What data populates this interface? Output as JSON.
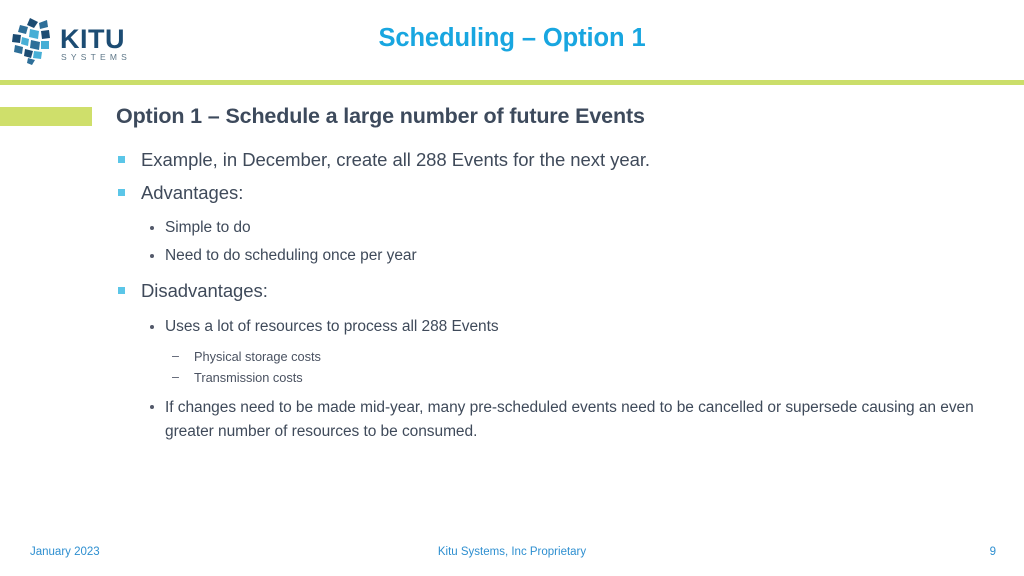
{
  "brand": {
    "logo_name": "kitu-systems-logo",
    "wordmark": "KITU",
    "tagline": "SYSTEMS",
    "mark_dark": "#1C4C73",
    "mark_light": "#47AFD6"
  },
  "header": {
    "title": "Scheduling – Option 1",
    "title_color": "#18A6E0",
    "rule_color": "#CBDE6A"
  },
  "section": {
    "heading": "Option 1 – Schedule a large number of future Events",
    "heading_color": "#3D4A5C",
    "accent_color": "#CFDF6B"
  },
  "bullets": {
    "marker_color_l1": "#5BC6E8",
    "marker_color_l2": "#53596A",
    "dash_glyph": "–",
    "items": [
      {
        "level": 1,
        "text": "Example, in December, create all 288 Events for the next year."
      },
      {
        "level": 1,
        "text": "Advantages:"
      },
      {
        "level": 2,
        "text": "Simple to do"
      },
      {
        "level": 2,
        "text": "Need to do scheduling once per year"
      },
      {
        "level": 1,
        "text": "Disadvantages:"
      },
      {
        "level": 2,
        "text": "Uses a lot of resources to process all 288 Events"
      },
      {
        "level": 3,
        "text": "Physical storage costs"
      },
      {
        "level": 3,
        "text": "Transmission costs"
      },
      {
        "level": 2,
        "text": "If changes need to be made mid-year, many pre-scheduled events need to be cancelled or supersede causing an even greater number of resources to be consumed."
      }
    ]
  },
  "footer": {
    "date": "January 2023",
    "notice": "Kitu Systems, Inc Proprietary",
    "page_number": "9",
    "color": "#2E8FD0"
  }
}
